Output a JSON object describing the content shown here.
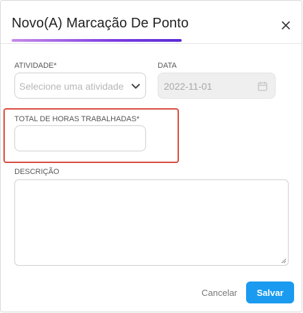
{
  "modal": {
    "title": "Novo(A) Marcação De Ponto",
    "close_icon": "close-icon"
  },
  "form": {
    "activity": {
      "label": "ATIVIDADE*",
      "placeholder": "Selecione uma atividade",
      "icon": "chevron-down-icon"
    },
    "date": {
      "label": "DATA",
      "value": "2022-11-01",
      "icon": "calendar-icon"
    },
    "hours": {
      "label": "TOTAL DE HORAS TRABALHADAS*",
      "value": ""
    },
    "description": {
      "label": "DESCRIÇÃO",
      "value": ""
    }
  },
  "footer": {
    "cancel_label": "Cancelar",
    "save_label": "Salvar"
  },
  "colors": {
    "accent": "#1a9bf0",
    "highlight": "#d9493c",
    "title_gradient_start": "#c58be8",
    "title_gradient_end": "#5a2bd6"
  }
}
